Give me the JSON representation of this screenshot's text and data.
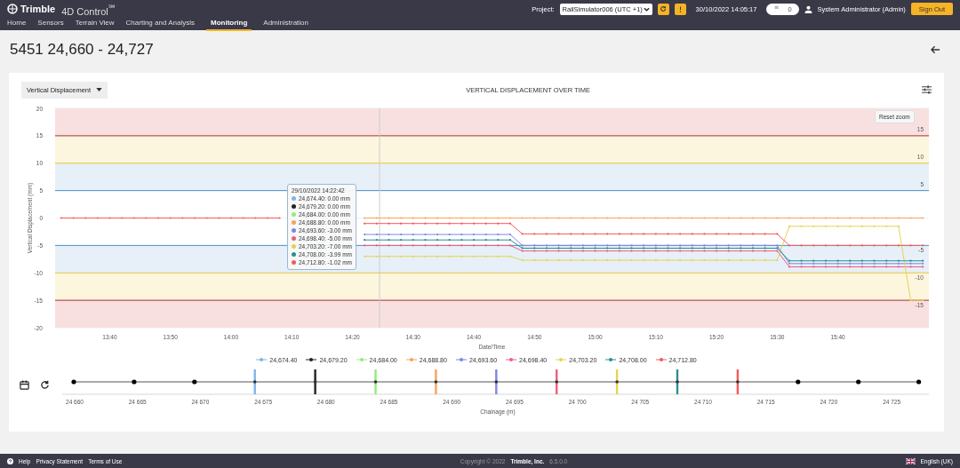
{
  "header": {
    "brand": "Trimble",
    "product": "4D Control$^{℠}$",
    "nav": [
      {
        "label": "Home",
        "selected": false
      },
      {
        "label": "Sensors",
        "selected": false
      },
      {
        "label": "Terrain View",
        "selected": false
      },
      {
        "label": "Charting and Analysis",
        "selected": false
      },
      {
        "label": "Monitoring",
        "selected": true
      },
      {
        "label": "Administration",
        "selected": false
      }
    ],
    "project_label": "Project:",
    "project": "RailSimulator006 (UTC +1)",
    "datetime": "30/10/2022 14:05:17",
    "notifications": "0",
    "user": "System Administrator (Admin)",
    "sign_out": "Sign Out"
  },
  "page_title": "5451 24,660 - 24,727",
  "displacement_panel": {
    "dropdown": "Vertical Displacement",
    "reset_zoom": "Reset zoom",
    "tooltip": {
      "time": "29/10/2022 14:22:42",
      "items": [
        {
          "text": "24,674.40: 0.00 mm",
          "color": "#7cb5ec"
        },
        {
          "text": "24,679.20: 0.00 mm",
          "color": "#222222"
        },
        {
          "text": "24,684.00: 0.00 mm",
          "color": "#90ed7d"
        },
        {
          "text": "24,688.80: 0.00 mm",
          "color": "#f7a35c"
        },
        {
          "text": "24,693.60: -3.00 mm",
          "color": "#8085e9"
        },
        {
          "text": "24,698.40: -5.00 mm",
          "color": "#f15c80"
        },
        {
          "text": "24,703.20: -7.00 mm",
          "color": "#e4d354"
        },
        {
          "text": "24,708.00: -3.99 mm",
          "color": "#2b908f"
        },
        {
          "text": "24,712.80: -1.02 mm",
          "color": "#f45b5b"
        }
      ]
    },
    "chart_data": {
      "type": "line",
      "title": "VERTICAL DISPLACEMENT OVER TIME",
      "xlabel": "Date/Time",
      "ylabel": "Vertical Displacement (mm)",
      "categories": [
        null,
        null,
        null,
        null,
        "13:40",
        null,
        null,
        null,
        null,
        "13:50",
        null,
        null,
        null,
        null,
        "14:00",
        null,
        null,
        null,
        null,
        "14:10",
        null,
        null,
        null,
        null,
        "14:20",
        null,
        null,
        null,
        null,
        "14:30",
        null,
        null,
        null,
        null,
        "14:40",
        null,
        null,
        null,
        null,
        "14:50",
        null,
        null,
        null,
        null,
        "15:00",
        null,
        null,
        null,
        null,
        "15:10",
        null,
        null,
        null,
        null,
        "15:20",
        null,
        null,
        null,
        null,
        "15:30",
        null,
        null,
        null,
        null,
        "15:40",
        null,
        null,
        null,
        null,
        null,
        null,
        null
      ],
      "ylim": [
        -20,
        20
      ],
      "yticks": [
        -20,
        -15,
        -10,
        -5,
        0,
        5,
        10,
        15,
        20
      ],
      "series": [
        {
          "name": "24,674.40",
          "color": "#7cb5ec",
          "values": [
            null,
            null,
            null,
            null,
            null,
            null,
            null,
            null,
            null,
            null,
            null,
            null,
            null,
            null,
            null,
            null,
            null,
            null,
            null,
            null,
            null,
            null,
            null,
            null,
            null,
            null,
            null,
            null,
            null,
            null,
            null,
            null,
            null,
            null,
            null,
            null,
            null,
            null,
            null,
            null,
            null,
            null,
            null,
            null,
            null,
            null,
            null,
            null,
            null,
            null,
            null,
            null,
            null,
            null,
            null,
            null,
            null,
            null,
            null,
            null,
            null,
            null,
            null,
            null,
            null,
            null,
            null,
            null,
            null,
            null,
            null,
            null
          ]
        },
        {
          "name": "24,679.20",
          "color": "#222222",
          "values": [
            null,
            null,
            null,
            null,
            null,
            null,
            null,
            null,
            null,
            null,
            null,
            null,
            null,
            null,
            null,
            null,
            null,
            null,
            null,
            null,
            null,
            null,
            null,
            null,
            null,
            null,
            null,
            null,
            null,
            null,
            null,
            null,
            null,
            null,
            null,
            null,
            null,
            null,
            null,
            null,
            null,
            null,
            null,
            null,
            null,
            null,
            null,
            null,
            null,
            null,
            null,
            null,
            null,
            null,
            null,
            null,
            null,
            null,
            null,
            null,
            null,
            null,
            null,
            null,
            null,
            null,
            null,
            null,
            null,
            null,
            null,
            null
          ]
        },
        {
          "name": "24,684.00",
          "color": "#90ed7d",
          "values": [
            null,
            null,
            null,
            null,
            null,
            null,
            null,
            null,
            null,
            null,
            null,
            null,
            null,
            null,
            null,
            null,
            null,
            null,
            null,
            null,
            null,
            null,
            null,
            null,
            null,
            null,
            null,
            null,
            null,
            null,
            null,
            null,
            null,
            null,
            null,
            null,
            null,
            null,
            null,
            null,
            null,
            null,
            null,
            null,
            null,
            null,
            null,
            null,
            null,
            null,
            null,
            null,
            null,
            null,
            null,
            null,
            null,
            null,
            null,
            null,
            null,
            null,
            null,
            null,
            null,
            null,
            null,
            null,
            null,
            null,
            null,
            null
          ]
        },
        {
          "name": "24,688.80",
          "color": "#f7a35c",
          "values": [
            null,
            null,
            null,
            null,
            null,
            null,
            null,
            null,
            null,
            null,
            null,
            null,
            null,
            null,
            null,
            null,
            null,
            null,
            null,
            null,
            null,
            null,
            null,
            null,
            null,
            0,
            0,
            0,
            0,
            0,
            0,
            0,
            0,
            0,
            0,
            0,
            0,
            0,
            0,
            0,
            0,
            0,
            0,
            0,
            0,
            0,
            0,
            0,
            0,
            0,
            0,
            0,
            0,
            0,
            0,
            0,
            0,
            0,
            0,
            0,
            0,
            0,
            0,
            0,
            0,
            0,
            0,
            0,
            0,
            0,
            0,
            0
          ]
        },
        {
          "name": "24,693.60",
          "color": "#8085e9",
          "values": [
            null,
            null,
            null,
            null,
            null,
            null,
            null,
            null,
            null,
            null,
            null,
            null,
            null,
            null,
            null,
            null,
            null,
            null,
            null,
            null,
            null,
            null,
            null,
            null,
            null,
            -3,
            -3,
            -3,
            -3,
            -3,
            -3,
            -3,
            -3,
            -3,
            -3,
            -3,
            -3,
            -3,
            -5,
            -5,
            -5,
            -5,
            -5,
            -5,
            -5,
            -5,
            -5,
            -5,
            -5,
            -5,
            -5,
            -5,
            -5,
            -5,
            -5,
            -5,
            -5,
            -5,
            -5,
            -5,
            -8.3,
            -8.3,
            -8.3,
            -8.3,
            -8.3,
            -8.3,
            -8.3,
            -8.3,
            -8.3,
            -8.3,
            -8.3,
            -8.3
          ]
        },
        {
          "name": "24,698.40",
          "color": "#f15c80",
          "values": [
            null,
            null,
            null,
            null,
            null,
            null,
            null,
            null,
            null,
            null,
            null,
            null,
            null,
            null,
            null,
            null,
            null,
            null,
            null,
            null,
            null,
            null,
            null,
            null,
            null,
            -5,
            -5,
            -5,
            -5,
            -5,
            -5,
            -5,
            -5,
            -5,
            -5,
            -5,
            -5,
            -5,
            -6,
            -6,
            -6,
            -6,
            -6,
            -6,
            -6,
            -6,
            -6,
            -6,
            -6,
            -6,
            -6,
            -6,
            -6,
            -6,
            -6,
            -6,
            -6,
            -6,
            -6,
            -6,
            -8.9,
            -8.9,
            -8.9,
            -8.9,
            -8.9,
            -8.9,
            -8.9,
            -8.9,
            -8.9,
            -8.9,
            -8.9,
            -8.9
          ]
        },
        {
          "name": "24,703.20",
          "color": "#e4d354",
          "values": [
            null,
            null,
            null,
            null,
            null,
            null,
            null,
            null,
            null,
            null,
            null,
            null,
            null,
            null,
            null,
            null,
            null,
            null,
            null,
            null,
            null,
            null,
            null,
            null,
            null,
            -7,
            -7,
            -7,
            -7,
            -7,
            -7,
            -7,
            -7,
            -7,
            -7,
            -7,
            -7,
            -7,
            -7.7,
            -7.7,
            -7.7,
            -7.7,
            -7.7,
            -7.7,
            -7.7,
            -7.7,
            -7.7,
            -7.7,
            -7.7,
            -7.7,
            -7.7,
            -7.7,
            -7.7,
            -7.7,
            -7.7,
            -7.7,
            -7.7,
            -7.7,
            -7.7,
            -7.7,
            -1.5,
            -1.5,
            -1.5,
            -1.5,
            -1.5,
            -1.5,
            -1.5,
            -1.5,
            -1.5,
            -1.5,
            -15,
            -15
          ]
        },
        {
          "name": "24,708.00",
          "color": "#2b908f",
          "values": [
            null,
            null,
            null,
            null,
            null,
            null,
            null,
            null,
            null,
            null,
            null,
            null,
            null,
            null,
            null,
            null,
            null,
            null,
            null,
            null,
            null,
            null,
            null,
            null,
            null,
            -4,
            -4,
            -4,
            -4,
            -4,
            -4,
            -4,
            -4,
            -4,
            -4,
            -4,
            -4,
            -4,
            -5.5,
            -5.5,
            -5.5,
            -5.5,
            -5.5,
            -5.5,
            -5.5,
            -5.5,
            -5.5,
            -5.5,
            -5.5,
            -5.5,
            -5.5,
            -5.5,
            -5.5,
            -5.5,
            -5.5,
            -5.5,
            -5.5,
            -5.5,
            -5.5,
            -5.5,
            -7.8,
            -7.8,
            -7.8,
            -7.8,
            -7.8,
            -7.8,
            -7.8,
            -7.8,
            -7.8,
            -7.8,
            -7.8,
            -7.8
          ]
        },
        {
          "name": "24,712.80",
          "color": "#f45b5b",
          "values": [
            0,
            0,
            0,
            0,
            0,
            0,
            0,
            0,
            0,
            0,
            0,
            0,
            0,
            0,
            0,
            0,
            0,
            0,
            0,
            null,
            null,
            null,
            null,
            null,
            null,
            -1,
            -1,
            -1,
            -1,
            -1,
            -1,
            -1,
            -1,
            -1,
            -1,
            -1,
            -1,
            -1,
            -2.9,
            -2.9,
            -2.9,
            -2.9,
            -2.9,
            -2.9,
            -2.9,
            -2.9,
            -2.9,
            -2.9,
            -2.9,
            -2.9,
            -2.9,
            -2.9,
            -2.9,
            -2.9,
            -2.9,
            -2.9,
            -2.9,
            -2.9,
            -2.9,
            -2.9,
            -5,
            -5,
            -5,
            -5,
            -5,
            -5,
            -5,
            -5,
            -5,
            -5,
            -5,
            -5
          ]
        }
      ],
      "ref_lines": [
        {
          "axis": "y",
          "value": 15,
          "label": "15",
          "color": "#b03030"
        },
        {
          "axis": "y",
          "value": 10,
          "label": "10",
          "color": "#e8c840"
        },
        {
          "axis": "y",
          "value": 5,
          "label": "5",
          "color": "#4a90c8"
        },
        {
          "axis": "y",
          "value": -5,
          "label": "-5",
          "color": "#4a90c8"
        },
        {
          "axis": "y",
          "value": -10,
          "label": "-10",
          "color": "#e8c840"
        },
        {
          "axis": "y",
          "value": -15,
          "label": "-15",
          "color": "#b03030"
        }
      ],
      "bands": [
        {
          "axis": "y",
          "from": 15,
          "to": 20,
          "color": "#f9e0e0"
        },
        {
          "axis": "y",
          "from": 10,
          "to": 15,
          "color": "#fcf6de"
        },
        {
          "axis": "y",
          "from": 5,
          "to": 10,
          "color": "#e7f0f8"
        },
        {
          "axis": "y",
          "from": -10,
          "to": -5,
          "color": "#e7f0f8"
        },
        {
          "axis": "y",
          "from": -15,
          "to": -10,
          "color": "#fcf6de"
        },
        {
          "axis": "y",
          "from": -20,
          "to": -15,
          "color": "#f9e0e0"
        }
      ]
    }
  },
  "chainage_panel": {
    "axis_title": "Chainage (m)",
    "ticks": [
      "24 660",
      "24 665",
      "24 670",
      "24 675",
      "24 680",
      "24 685",
      "24 690",
      "24 695",
      "24 700",
      "24 705",
      "24 710",
      "24 715",
      "24 720",
      "24 725"
    ],
    "points": [
      {
        "kind": "plain"
      },
      {
        "kind": "plain"
      },
      {
        "kind": "plain"
      },
      {
        "kind": "sensor",
        "color": "#7cb5ec"
      },
      {
        "kind": "sensor",
        "color": "#222222"
      },
      {
        "kind": "sensor",
        "color": "#90ed7d"
      },
      {
        "kind": "sensor",
        "color": "#f7a35c"
      },
      {
        "kind": "sensor",
        "color": "#8085e9"
      },
      {
        "kind": "sensor",
        "color": "#f15c80"
      },
      {
        "kind": "sensor",
        "color": "#e4d354"
      },
      {
        "kind": "sensor",
        "color": "#2b908f"
      },
      {
        "kind": "sensor",
        "color": "#f45b5b"
      },
      {
        "kind": "plain"
      },
      {
        "kind": "plain"
      },
      {
        "kind": "plain"
      }
    ]
  },
  "footer": {
    "links": [
      "Help",
      "Privacy Statement",
      "Terms of Use"
    ],
    "copyright": "Copyright © 2022",
    "company": "Trimble, Inc.",
    "version": "6.5.0.0",
    "language": "English (UK)"
  }
}
